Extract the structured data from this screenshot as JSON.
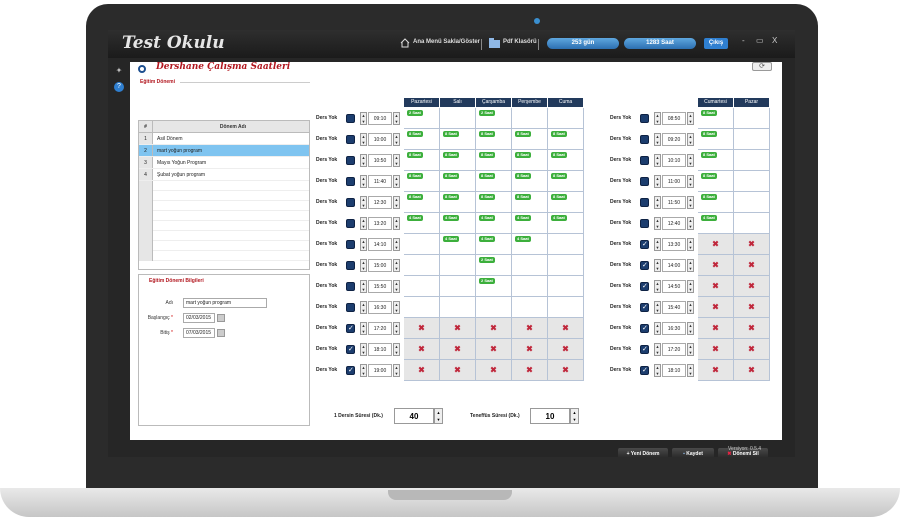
{
  "app": {
    "title": "Test Okulu",
    "version": "Versiyon: 0.5.4"
  },
  "topbar": {
    "menu_toggle": "Ana Menü Sakla/Göster",
    "pdf": "Pdf Klasörü",
    "days": "253 gün",
    "hours": "1283 Saat",
    "logout": "Çıkış"
  },
  "window": {
    "minimize": "-",
    "restore": "▭",
    "close": "X"
  },
  "page": {
    "title": "Dershane Çalışma Saatleri",
    "section_period": "Eğitim Dönemi",
    "section_info": "Eğitim Dönemi Bilgileri"
  },
  "period_table": {
    "headers": [
      "#",
      "Dönem Adı"
    ],
    "rows": [
      {
        "num": "1",
        "name": "Asil Dönem"
      },
      {
        "num": "2",
        "name": "mart yoğun program"
      },
      {
        "num": "3",
        "name": "Mayıs Yoğun Program"
      },
      {
        "num": "4",
        "name": "Şubat yoğun program"
      }
    ],
    "selected_index": 1
  },
  "info": {
    "name_label": "Adı",
    "name_value": "mart yoğun program",
    "start_label": "Başlangıç",
    "start_value": "02/03/2015",
    "end_label": "Bitiş",
    "end_value": "07/03/2015"
  },
  "days_weekday": [
    "Pazartesi",
    "Salı",
    "Çarşamba",
    "Perşembe",
    "Cuma"
  ],
  "days_weekend": [
    "Cumartesi",
    "Pazar"
  ],
  "row_label": "Ders Yok",
  "weekday_rows": [
    {
      "time": "09:10",
      "checked": false,
      "cells": [
        "2 Saat",
        "",
        "2 Saat",
        "",
        ""
      ]
    },
    {
      "time": "10:00",
      "checked": false,
      "cells": [
        "8 Saat",
        "8 Saat",
        "8 Saat",
        "8 Saat",
        "8 Saat"
      ]
    },
    {
      "time": "10:50",
      "checked": false,
      "cells": [
        "8 Saat",
        "8 Saat",
        "8 Saat",
        "8 Saat",
        "8 Saat"
      ]
    },
    {
      "time": "11:40",
      "checked": false,
      "cells": [
        "8 Saat",
        "8 Saat",
        "8 Saat",
        "8 Saat",
        "8 Saat"
      ]
    },
    {
      "time": "12:30",
      "checked": false,
      "cells": [
        "8 Saat",
        "8 Saat",
        "8 Saat",
        "8 Saat",
        "8 Saat"
      ]
    },
    {
      "time": "13:20",
      "checked": false,
      "cells": [
        "4 Saat",
        "4 Saat",
        "4 Saat",
        "4 Saat",
        "4 Saat"
      ]
    },
    {
      "time": "14:10",
      "checked": false,
      "cells": [
        "",
        "4 Saat",
        "4 Saat",
        "4 Saat",
        ""
      ]
    },
    {
      "time": "15:00",
      "checked": false,
      "cells": [
        "",
        "",
        "2 Saat",
        "",
        ""
      ]
    },
    {
      "time": "15:50",
      "checked": false,
      "cells": [
        "",
        "",
        "2 Saat",
        "",
        ""
      ]
    },
    {
      "time": "16:30",
      "checked": false,
      "cells": [
        "",
        "",
        "",
        "",
        ""
      ]
    },
    {
      "time": "17:20",
      "checked": true,
      "cells": [
        "x",
        "x",
        "x",
        "x",
        "x"
      ]
    },
    {
      "time": "18:10",
      "checked": true,
      "cells": [
        "x",
        "x",
        "x",
        "x",
        "x"
      ]
    },
    {
      "time": "19:00",
      "checked": true,
      "cells": [
        "x",
        "x",
        "x",
        "x",
        "x"
      ]
    }
  ],
  "weekend_rows": [
    {
      "time": "08:50",
      "checked": false,
      "cells": [
        "8 Saat",
        ""
      ]
    },
    {
      "time": "09:20",
      "checked": false,
      "cells": [
        "8 Saat",
        ""
      ]
    },
    {
      "time": "10:10",
      "checked": false,
      "cells": [
        "8 Saat",
        ""
      ]
    },
    {
      "time": "11:00",
      "checked": false,
      "cells": [
        "8 Saat",
        ""
      ]
    },
    {
      "time": "11:50",
      "checked": false,
      "cells": [
        "8 Saat",
        ""
      ]
    },
    {
      "time": "12:40",
      "checked": false,
      "cells": [
        "4 Saat",
        ""
      ]
    },
    {
      "time": "13:30",
      "checked": true,
      "cells": [
        "x",
        "x"
      ]
    },
    {
      "time": "14:00",
      "checked": true,
      "cells": [
        "x",
        "x"
      ]
    },
    {
      "time": "14:50",
      "checked": true,
      "cells": [
        "x",
        "x"
      ]
    },
    {
      "time": "15:40",
      "checked": true,
      "cells": [
        "x",
        "x"
      ]
    },
    {
      "time": "16:30",
      "checked": true,
      "cells": [
        "x",
        "x"
      ]
    },
    {
      "time": "17:20",
      "checked": true,
      "cells": [
        "x",
        "x"
      ]
    },
    {
      "time": "18:10",
      "checked": true,
      "cells": [
        "x",
        "x"
      ]
    }
  ],
  "lesson": {
    "label": "1 Dersin Süresi (Dk.)",
    "value": "40"
  },
  "break": {
    "label": "Teneffüs Süresi (Dk.)",
    "value": "10"
  },
  "actions": {
    "new": "Yeni Dönem",
    "save": "Kaydet",
    "delete": "Dönemi Sil"
  },
  "colors": {
    "accent": "#2f7fd0",
    "title_red": "#b2171f",
    "badge_green": "#3caf3c",
    "header_navy": "#223a5c"
  }
}
